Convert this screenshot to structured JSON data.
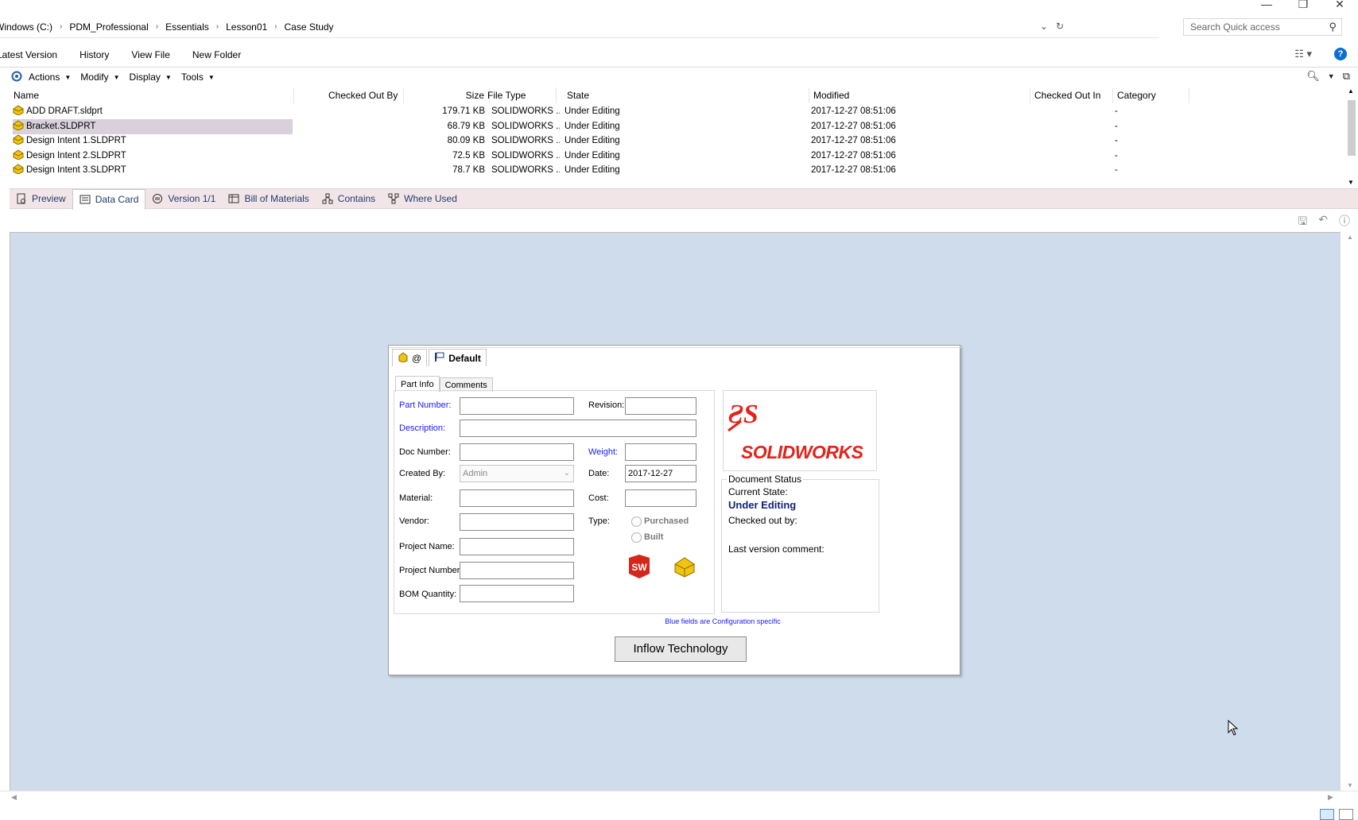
{
  "window": {
    "controls": [
      "—",
      "❐",
      "✕"
    ]
  },
  "address": {
    "crumbs": [
      "Windows (C:)",
      "PDM_Professional",
      "Essentials",
      "Lesson01",
      "Case Study"
    ],
    "search_placeholder": "Search Quick access"
  },
  "command_bar": [
    "Latest Version",
    "History",
    "View File",
    "New Folder"
  ],
  "menu": [
    "Actions",
    "Modify",
    "Display",
    "Tools"
  ],
  "columns": [
    "Name",
    "Checked Out By",
    "Size",
    "File Type",
    "State",
    "Modified",
    "Checked Out In",
    "Category"
  ],
  "files": [
    {
      "name": "ADD DRAFT.sldprt",
      "checked_out_by": "",
      "size": "179.71 KB",
      "type": "SOLIDWORKS ...",
      "state": "Under Editing",
      "modified": "2017-12-27 08:51:06",
      "checked_out_in": "",
      "category": "-"
    },
    {
      "name": "Bracket.SLDPRT",
      "checked_out_by": "",
      "size": "68.79 KB",
      "type": "SOLIDWORKS ...",
      "state": "Under Editing",
      "modified": "2017-12-27 08:51:06",
      "checked_out_in": "",
      "category": "-"
    },
    {
      "name": "Design Intent 1.SLDPRT",
      "checked_out_by": "",
      "size": "80.09 KB",
      "type": "SOLIDWORKS ...",
      "state": "Under Editing",
      "modified": "2017-12-27 08:51:06",
      "checked_out_in": "",
      "category": "-"
    },
    {
      "name": "Design Intent 2.SLDPRT",
      "checked_out_by": "",
      "size": "72.5 KB",
      "type": "SOLIDWORKS ...",
      "state": "Under Editing",
      "modified": "2017-12-27 08:51:06",
      "checked_out_in": "",
      "category": "-"
    },
    {
      "name": "Design Intent 3.SLDPRT",
      "checked_out_by": "",
      "size": "78.7 KB",
      "type": "SOLIDWORKS ...",
      "state": "Under Editing",
      "modified": "2017-12-27 08:51:06",
      "checked_out_in": "",
      "category": "-"
    }
  ],
  "selected_file": "Bracket.SLDPRT",
  "tabs": [
    "Preview",
    "Data Card",
    "Version 1/1",
    "Bill of Materials",
    "Contains",
    "Where Used"
  ],
  "active_tab": "Data Card",
  "card": {
    "config_label": "@",
    "default_label": "Default",
    "inner_tabs": [
      "Part Info",
      "Comments"
    ],
    "fields": {
      "part_number": "Part Number:",
      "revision": "Revision:",
      "description": "Description:",
      "doc_number": "Doc Number:",
      "weight": "Weight:",
      "created_by": "Created By:",
      "created_by_value": "Admin",
      "date": "Date:",
      "date_value": "2017-12-27",
      "material": "Material:",
      "cost": "Cost:",
      "vendor": "Vendor:",
      "type": "Type:",
      "purchased": "Purchased",
      "built": "Built",
      "project_name": "Project Name:",
      "project_number": "Project Number:",
      "bom_quantity": "BOM Quantity:"
    },
    "logo_text": "SOLIDWORKS",
    "status": {
      "legend": "Document Status",
      "current_state_label": "Current State:",
      "current_state": "Under Editing",
      "checked_out_by": "Checked out by:",
      "last_comment": "Last version comment:"
    },
    "note": "Blue fields are Configuration specific",
    "button": "Inflow Technology"
  },
  "colors": {
    "preview_bg": "#cfdcec",
    "tab_strip": "#f2e5e8",
    "blue_label": "#1a1aff",
    "state_blue": "#12237a",
    "sw_red": "#e2231a"
  }
}
